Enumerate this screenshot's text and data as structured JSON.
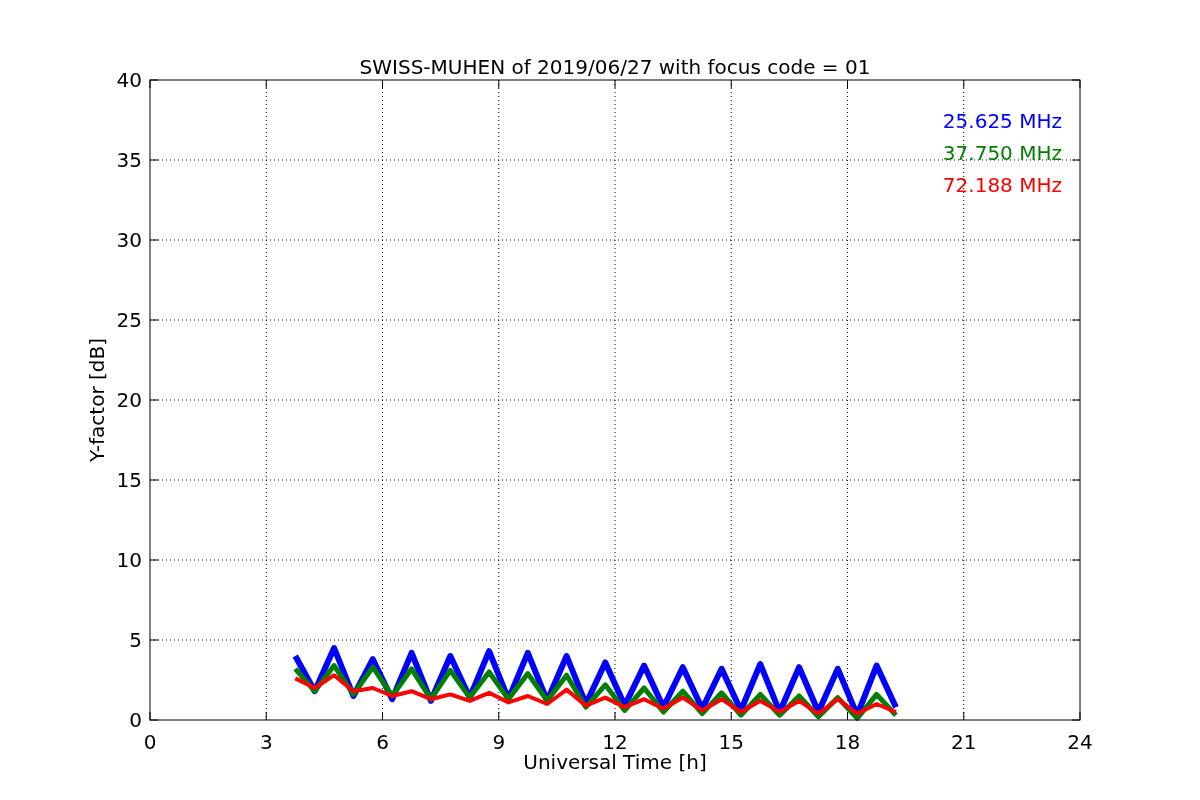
{
  "chart_data": {
    "type": "line",
    "title": "SWISS-MUHEN of 2019/06/27 with focus code = 01",
    "xlabel": "Universal Time [h]",
    "ylabel": "Y-factor [dB]",
    "x": [
      3.75,
      4.25,
      4.75,
      5.25,
      5.75,
      6.25,
      6.75,
      7.25,
      7.75,
      8.25,
      8.75,
      9.25,
      9.75,
      10.25,
      10.75,
      11.25,
      11.75,
      12.25,
      12.75,
      13.25,
      13.75,
      14.25,
      14.75,
      15.25,
      15.75,
      16.25,
      16.75,
      17.25,
      17.75,
      18.25,
      18.75,
      19.25
    ],
    "series": [
      {
        "name": "25.625 MHz",
        "color": "#0000ff",
        "values": [
          4.0,
          1.8,
          4.5,
          1.5,
          3.8,
          1.3,
          4.2,
          1.2,
          4.0,
          1.4,
          4.3,
          1.3,
          4.2,
          1.2,
          4.0,
          1.0,
          3.6,
          0.9,
          3.4,
          0.8,
          3.3,
          0.7,
          3.2,
          0.6,
          3.5,
          0.5,
          3.3,
          0.5,
          3.2,
          0.3,
          3.4,
          0.8
        ]
      },
      {
        "name": "37.750 MHz",
        "color": "#008000",
        "values": [
          3.2,
          1.8,
          3.4,
          1.6,
          3.3,
          1.5,
          3.2,
          1.3,
          3.1,
          1.4,
          3.0,
          1.3,
          2.9,
          1.2,
          2.8,
          0.8,
          2.2,
          0.6,
          2.0,
          0.5,
          1.8,
          0.4,
          1.7,
          0.3,
          1.6,
          0.3,
          1.5,
          0.2,
          1.4,
          0.1,
          1.6,
          0.3
        ]
      },
      {
        "name": "72.188 MHz",
        "color": "#ff0000",
        "values": [
          2.6,
          2.0,
          2.8,
          1.8,
          2.0,
          1.5,
          1.8,
          1.3,
          1.6,
          1.2,
          1.7,
          1.1,
          1.5,
          1.0,
          1.9,
          0.9,
          1.4,
          0.8,
          1.3,
          0.7,
          1.4,
          0.6,
          1.3,
          0.5,
          1.2,
          0.5,
          1.2,
          0.4,
          1.3,
          0.4,
          1.0,
          0.5
        ]
      }
    ],
    "xlim": [
      0,
      24
    ],
    "ylim": [
      0,
      40
    ],
    "xticks": [
      0,
      3,
      6,
      9,
      12,
      15,
      18,
      21,
      24
    ],
    "yticks": [
      0,
      5,
      10,
      15,
      20,
      25,
      30,
      35,
      40
    ],
    "grid": true
  }
}
